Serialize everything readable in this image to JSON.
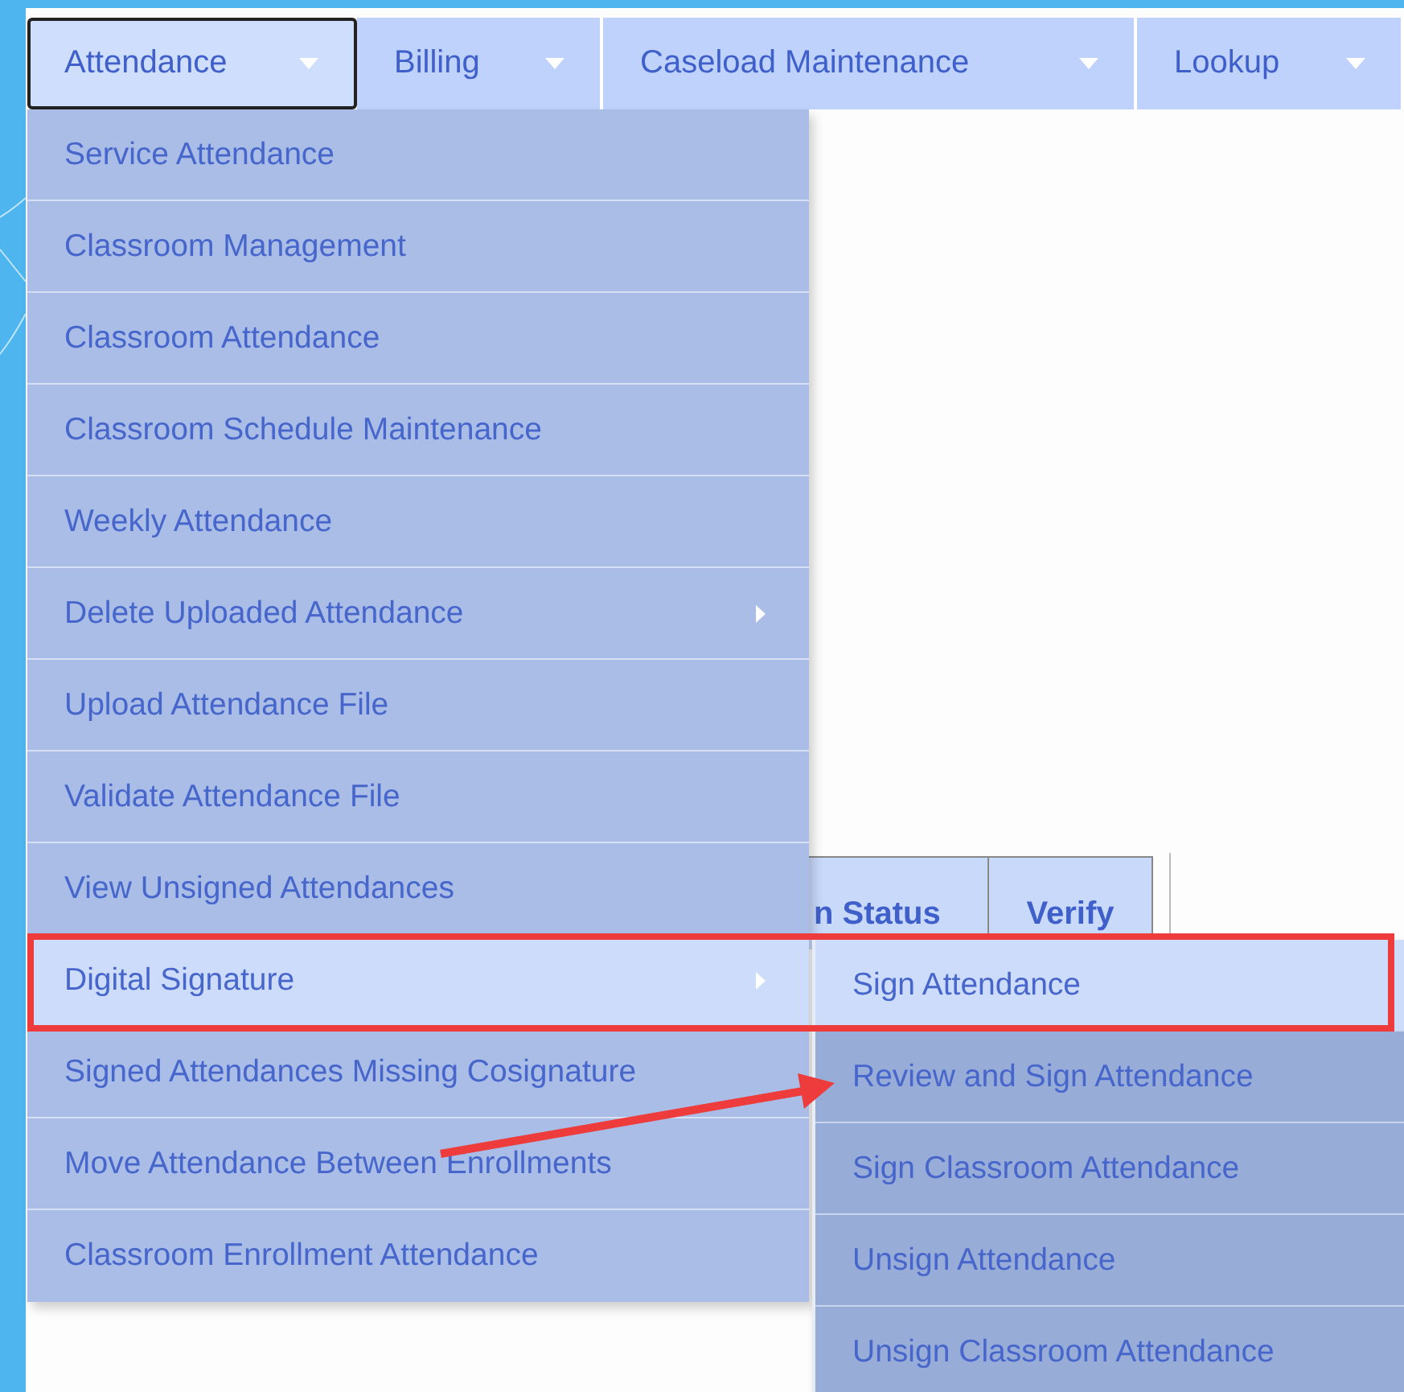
{
  "nav": {
    "tabs": [
      {
        "label": "Attendance",
        "selected": true
      },
      {
        "label": "Billing",
        "selected": false
      },
      {
        "label": "Caseload Maintenance",
        "selected": false
      },
      {
        "label": "Lookup",
        "selected": false
      }
    ]
  },
  "background_table": {
    "columns": [
      "n Status",
      "Verify"
    ]
  },
  "menu": {
    "items": [
      {
        "label": "Service Attendance",
        "selected": false,
        "has_submenu": false
      },
      {
        "label": "Classroom Management",
        "selected": false,
        "has_submenu": false
      },
      {
        "label": "Classroom Attendance",
        "selected": false,
        "has_submenu": false
      },
      {
        "label": "Classroom Schedule Maintenance",
        "selected": false,
        "has_submenu": false
      },
      {
        "label": "Weekly Attendance",
        "selected": false,
        "has_submenu": false
      },
      {
        "label": "Delete Uploaded Attendance",
        "selected": false,
        "has_submenu": true
      },
      {
        "label": "Upload Attendance File",
        "selected": false,
        "has_submenu": false
      },
      {
        "label": "Validate Attendance File",
        "selected": false,
        "has_submenu": false
      },
      {
        "label": "View Unsigned Attendances",
        "selected": false,
        "has_submenu": false
      },
      {
        "label": "Digital Signature",
        "selected": true,
        "has_submenu": true
      },
      {
        "label": "Signed Attendances Missing Cosignature",
        "selected": false,
        "has_submenu": false
      },
      {
        "label": "Move Attendance Between Enrollments",
        "selected": false,
        "has_submenu": false
      },
      {
        "label": "Classroom Enrollment Attendance",
        "selected": false,
        "has_submenu": false
      }
    ]
  },
  "submenu": {
    "items": [
      {
        "label": "Sign Attendance",
        "selected": true
      },
      {
        "label": "Review and Sign Attendance",
        "selected": false
      },
      {
        "label": "Sign Classroom Attendance",
        "selected": false
      },
      {
        "label": "Unsign Attendance",
        "selected": false
      },
      {
        "label": "Unsign Classroom Attendance",
        "selected": false
      }
    ]
  },
  "annotations": {
    "highlight_box": true,
    "pointer_arrow": true
  }
}
